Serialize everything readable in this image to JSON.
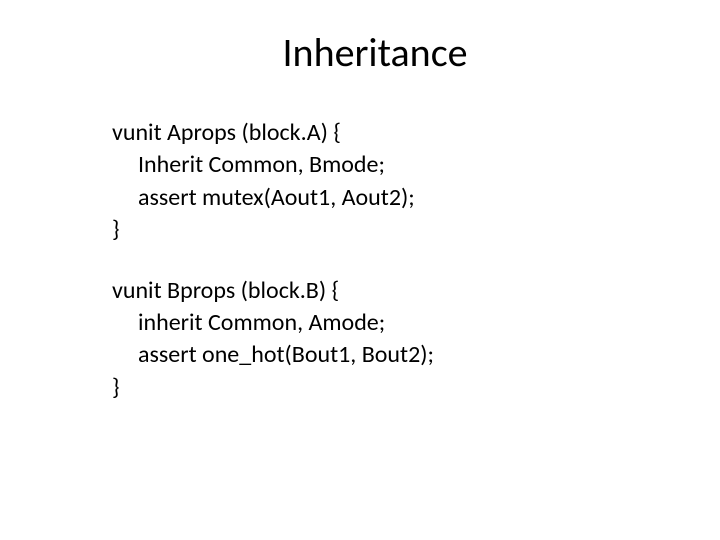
{
  "title": "Inheritance",
  "blocks": [
    {
      "decl": "vunit Aprops (block.A) {",
      "line1": "Inherit Common, Bmode;",
      "line2": "assert mutex(Aout1, Aout2);",
      "close": "}"
    },
    {
      "decl": "vunit Bprops (block.B) {",
      "line1": "inherit Common, Amode;",
      "line2": "assert one_hot(Bout1, Bout2);",
      "close": "}"
    }
  ]
}
